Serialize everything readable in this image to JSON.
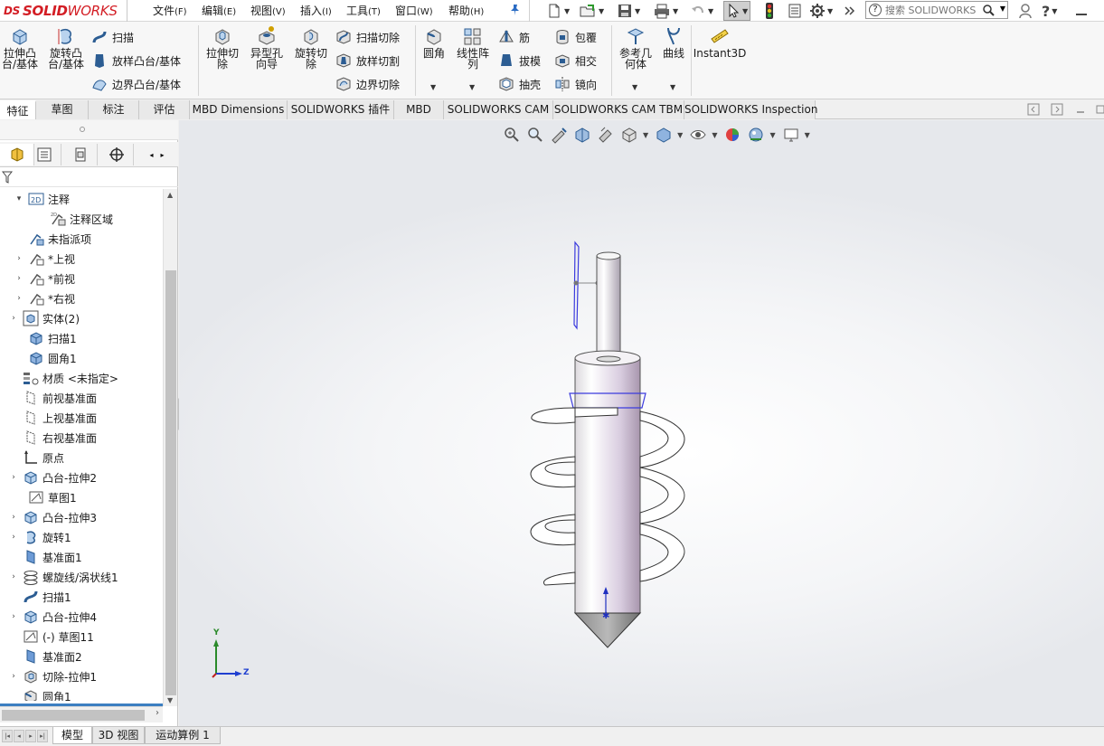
{
  "app": {
    "logo_prefix": "DS",
    "logo_solid": "SOLID",
    "logo_works": "WORKS"
  },
  "menu": [
    {
      "label": "文件",
      "acc": "(F)"
    },
    {
      "label": "编辑",
      "acc": "(E)"
    },
    {
      "label": "视图",
      "acc": "(V)"
    },
    {
      "label": "插入",
      "acc": "(I)"
    },
    {
      "label": "工具",
      "acc": "(T)"
    },
    {
      "label": "窗口",
      "acc": "(W)"
    },
    {
      "label": "帮助",
      "acc": "(H)"
    }
  ],
  "search": {
    "placeholder": "搜索 SOLIDWORKS"
  },
  "ribbon": {
    "extrude_boss": "拉伸凸\n台/基体",
    "revolve_boss": "旋转凸\n台/基体",
    "sweep": "扫描",
    "loft_boss": "放样凸台/基体",
    "boundary_boss": "边界凸台/基体",
    "extrude_cut": "拉伸切\n除",
    "hole_wizard": "异型孔\n向导",
    "revolve_cut": "旋转切\n除",
    "swept_cut": "扫描切除",
    "lofted_cut": "放样切割",
    "boundary_cut": "边界切除",
    "fillet": "圆角",
    "linear_pattern": "线性阵\n列",
    "rib": "筋",
    "draft": "拔模",
    "shell": "抽壳",
    "wrap": "包覆",
    "intersect": "相交",
    "mirror": "镜向",
    "ref_geometry": "参考几\n何体",
    "curves": "曲线",
    "instant3d": "Instant3D"
  },
  "tabs": [
    "特征",
    "草图",
    "标注",
    "评估",
    "MBD Dimensions",
    "SOLIDWORKS 插件",
    "MBD",
    "SOLIDWORKS CAM",
    "SOLIDWORKS CAM TBM",
    "SOLIDWORKS Inspection"
  ],
  "tree": [
    {
      "label": "注释",
      "indent": 1,
      "exp": "▾",
      "icon": "annotation-icon"
    },
    {
      "label": "注释区域",
      "indent": 2,
      "exp": "",
      "icon": "annotation-area-icon"
    },
    {
      "label": "未指派项",
      "indent": 1,
      "exp": "",
      "icon": "unassigned-icon"
    },
    {
      "label": "*上视",
      "indent": 1,
      "exp": "›",
      "icon": "view-icon"
    },
    {
      "label": "*前视",
      "indent": 1,
      "exp": "›",
      "icon": "view-icon"
    },
    {
      "label": "*右视",
      "indent": 1,
      "exp": "›",
      "icon": "view-icon"
    },
    {
      "label": "实体(2)",
      "indent": 0,
      "exp": "›",
      "icon": "solid-bodies-icon"
    },
    {
      "label": "扫描1",
      "indent": 1,
      "exp": "",
      "icon": "body-icon"
    },
    {
      "label": "圆角1",
      "indent": 1,
      "exp": "",
      "icon": "body-icon"
    },
    {
      "label": "材质 <未指定>",
      "indent": 0,
      "exp": "",
      "icon": "material-icon"
    },
    {
      "label": "前视基准面",
      "indent": 0,
      "exp": "",
      "icon": "plane-icon"
    },
    {
      "label": "上视基准面",
      "indent": 0,
      "exp": "",
      "icon": "plane-icon"
    },
    {
      "label": "右视基准面",
      "indent": 0,
      "exp": "",
      "icon": "plane-icon"
    },
    {
      "label": "原点",
      "indent": 0,
      "exp": "",
      "icon": "origin-icon"
    },
    {
      "label": "凸台-拉伸2",
      "indent": 0,
      "exp": "›",
      "icon": "extrude-icon"
    },
    {
      "label": "草图1",
      "indent": 1,
      "exp": "",
      "icon": "sketch-icon"
    },
    {
      "label": "凸台-拉伸3",
      "indent": 0,
      "exp": "›",
      "icon": "extrude-icon"
    },
    {
      "label": "旋转1",
      "indent": 0,
      "exp": "›",
      "icon": "revolve-icon"
    },
    {
      "label": "基准面1",
      "indent": 0,
      "exp": "",
      "icon": "plane-solid-icon"
    },
    {
      "label": "螺旋线/涡状线1",
      "indent": 0,
      "exp": "›",
      "icon": "helix-icon"
    },
    {
      "label": "扫描1",
      "indent": 0,
      "exp": "",
      "icon": "sweep-icon"
    },
    {
      "label": "凸台-拉伸4",
      "indent": 0,
      "exp": "›",
      "icon": "extrude-icon"
    },
    {
      "label": "(-) 草图11",
      "indent": 0,
      "exp": "",
      "icon": "sketch-icon"
    },
    {
      "label": "基准面2",
      "indent": 0,
      "exp": "",
      "icon": "plane-solid-icon"
    },
    {
      "label": "切除-拉伸1",
      "indent": 0,
      "exp": "›",
      "icon": "cut-extrude-icon"
    },
    {
      "label": "圆角1",
      "indent": 0,
      "exp": "",
      "icon": "fillet-icon"
    }
  ],
  "bottom_tabs": [
    "模型",
    "3D 视图",
    "运动算例 1"
  ],
  "triad": {
    "y": "Y",
    "z": "Z"
  },
  "colors": {
    "accent": "#3c7fc1",
    "logo": "#d31d24",
    "axis_y": "#2a8a2a",
    "axis_z": "#1f3fd0",
    "sketch_blue": "#3b3bdd"
  }
}
